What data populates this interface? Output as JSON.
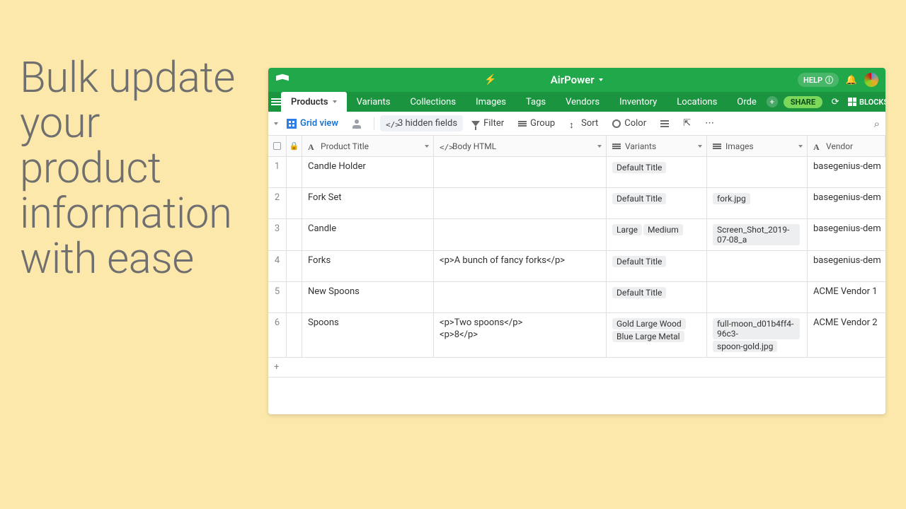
{
  "marketing_heading": "Bulk update your product information with ease",
  "app_title": "AirPower",
  "help_label": "HELP",
  "share_label": "SHARE",
  "blocks_label": "BLOCKS",
  "tabs": [
    {
      "label": "Products",
      "active": true
    },
    {
      "label": "Variants"
    },
    {
      "label": "Collections"
    },
    {
      "label": "Images"
    },
    {
      "label": "Tags"
    },
    {
      "label": "Vendors"
    },
    {
      "label": "Inventory"
    },
    {
      "label": "Locations"
    },
    {
      "label": "Orde"
    }
  ],
  "toolbar": {
    "view_label": "Grid view",
    "hidden_fields": "3 hidden fields",
    "filter": "Filter",
    "group": "Group",
    "sort": "Sort",
    "color": "Color"
  },
  "columns": {
    "title": "Product Title",
    "body": "Body HTML",
    "variants": "Variants",
    "images": "Images",
    "vendor": "Vendor"
  },
  "rows": [
    {
      "n": "1",
      "title": "Candle Holder",
      "body": [],
      "variants": [
        "Default Title"
      ],
      "images": [],
      "vendor": "basegenius-dem"
    },
    {
      "n": "2",
      "title": "Fork Set",
      "body": [],
      "variants": [
        "Default Title"
      ],
      "images": [
        "fork.jpg"
      ],
      "vendor": "basegenius-dem"
    },
    {
      "n": "3",
      "title": "Candle",
      "body": [],
      "variants": [
        "Large",
        "Medium"
      ],
      "images": [
        "Screen_Shot_2019-07-08_a"
      ],
      "vendor": "basegenius-dem"
    },
    {
      "n": "4",
      "title": "Forks",
      "body": [
        "<p>A bunch of fancy forks</p>"
      ],
      "variants": [
        "Default Title"
      ],
      "images": [],
      "vendor": "basegenius-dem"
    },
    {
      "n": "5",
      "title": "New Spoons",
      "body": [],
      "variants": [
        "Default Title"
      ],
      "images": [],
      "vendor": "ACME Vendor 1"
    },
    {
      "n": "6",
      "title": "Spoons",
      "body": [
        "<p>Two spoons</p>",
        "<p>8</p>"
      ],
      "variants": [
        "Gold Large Wood",
        "Blue Large Metal"
      ],
      "images": [
        "full-moon_d01b4ff4-96c3-",
        "spoon-gold.jpg"
      ],
      "vendor": "ACME Vendor 2"
    }
  ],
  "add_row": "+"
}
